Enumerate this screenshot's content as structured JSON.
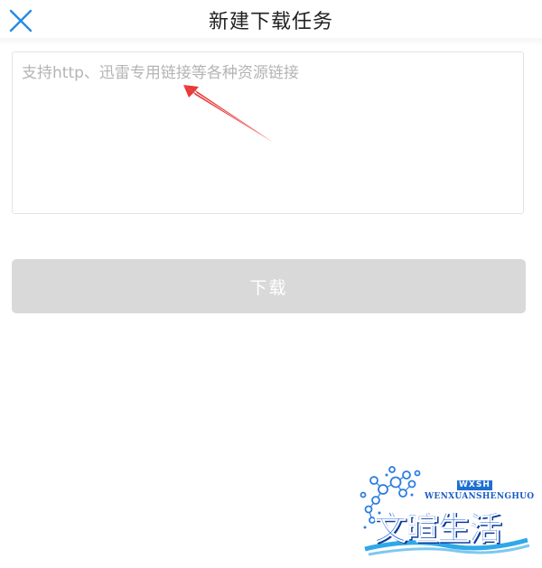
{
  "header": {
    "title": "新建下载任务",
    "close_icon": "close-icon"
  },
  "link_input": {
    "value": "",
    "placeholder": "支持http、迅雷专用链接等各种资源链接"
  },
  "annotation": {
    "icon": "red-arrow-icon",
    "color": "#e83a3a"
  },
  "download_button": {
    "label": "下载",
    "background": "#d9d9d9",
    "enabled": false
  },
  "watermark": {
    "badge": "WXSH",
    "domain": "WENXUANSHENGHUO",
    "name": "文暄生活",
    "color": "#1c60d8"
  },
  "colors": {
    "accent": "#2a8ae0",
    "placeholder": "#b4b4b4",
    "border": "#e3e3e3"
  }
}
